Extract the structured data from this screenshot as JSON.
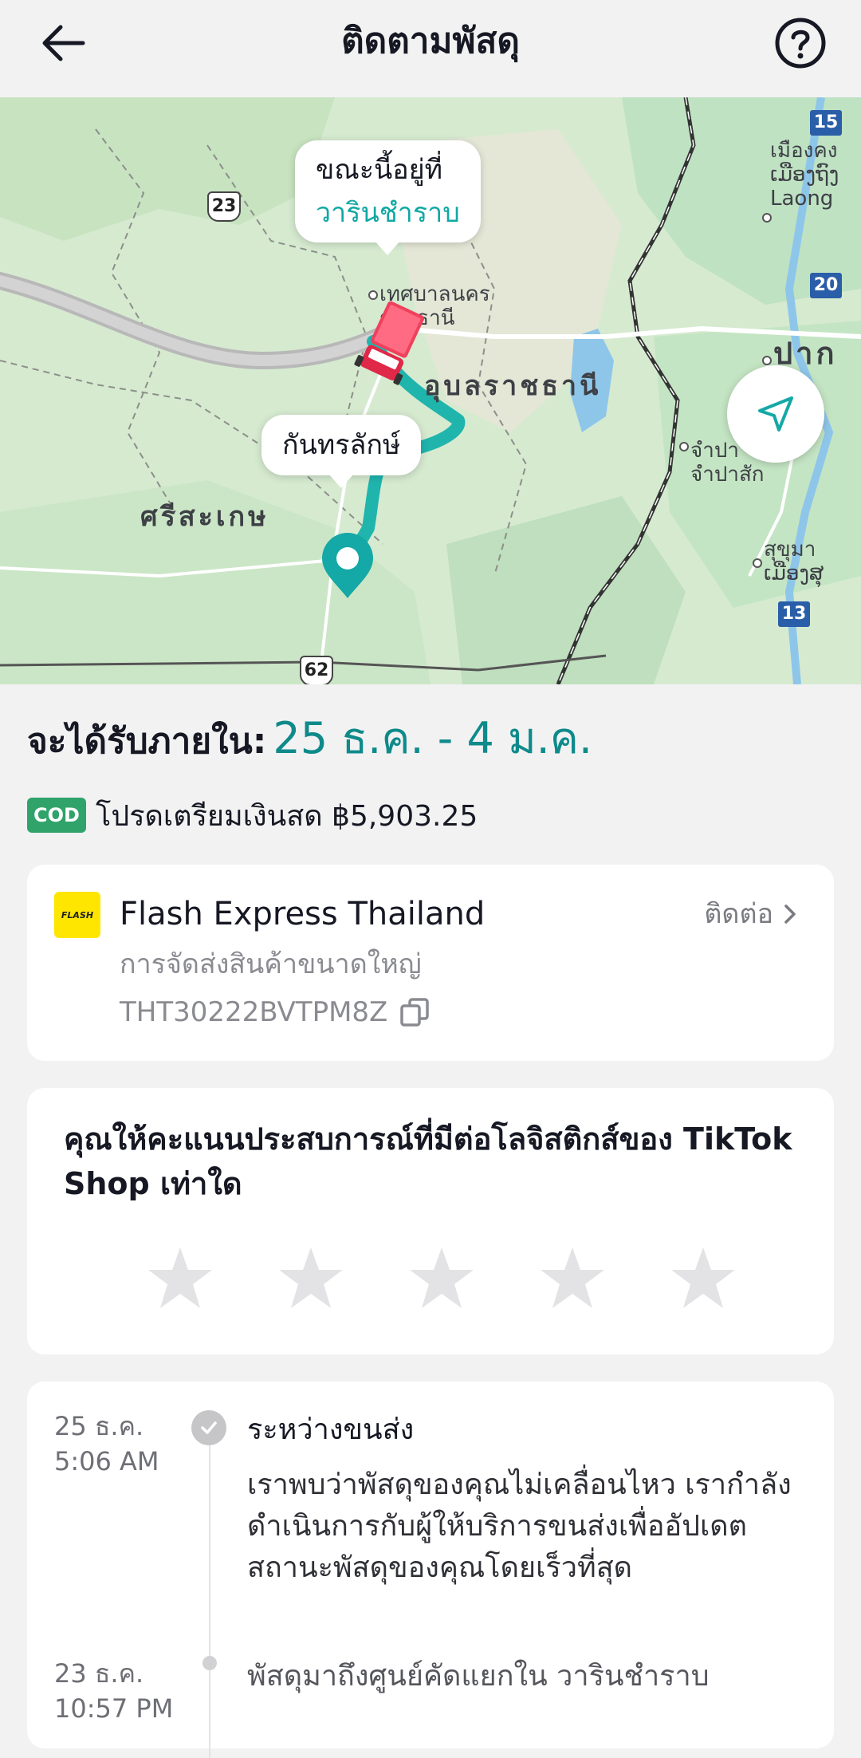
{
  "header": {
    "title": "ติดตามพัสดุ",
    "back_icon": "arrow-left-icon",
    "help_icon": "question-circle-icon"
  },
  "map": {
    "current_location_bubble": {
      "line1": "ขณะนี้อยู่ที่",
      "line2": "วารินชำราบ"
    },
    "destination_bubble": "กันทรลักษ์",
    "labels": {
      "ubon_city": "เทศบาลนคร\nราชธานี",
      "ubon_province": "อุบลราชธานี",
      "sisaket": "ศรีสะเกษ",
      "pakse": "ปากเซ",
      "champasak": "จำปา\nจำปาสัก",
      "khong": "เมืองคง\nເມືອງຖົງ\nLaong",
      "sukhuma": "สุขุมา\nເມືອງສຸ"
    },
    "road_numbers": [
      "23",
      "15",
      "20",
      "13",
      "62"
    ],
    "colors": {
      "route": "#1fb5ad",
      "pin": "#14a8a6",
      "truck": "#f0405c"
    }
  },
  "eta": {
    "label": "จะได้รับภายใน:",
    "date_range": "25 ธ.ค. - 4 ม.ค."
  },
  "cod": {
    "badge": "COD",
    "text": "โปรดเตรียมเงินสด ฿5,903.25"
  },
  "carrier": {
    "logo_text": "FLASH",
    "name": "Flash Express Thailand",
    "contact_label": "ติดต่อ",
    "service": "การจัดส่งสินค้าขนาดใหญ่",
    "tracking_number": "THT30222BVTPM8Z"
  },
  "rating": {
    "question": "คุณให้คะแนนประสบการณ์ที่มีต่อโลจิสติกส์ของ TikTok Shop เท่าใด",
    "stars_selected": 0,
    "stars_total": 5
  },
  "timeline": [
    {
      "date": "25 ธ.ค.",
      "time": "5:06 AM",
      "status": "ระหว่างขนส่ง",
      "description": "เราพบว่าพัสดุของคุณไม่เคลื่อนไหว เรากำลังดำเนินการกับผู้ให้บริการขนส่งเพื่ออัปเดตสถานะพัสดุของคุณโดยเร็วที่สุด"
    },
    {
      "date": "23 ธ.ค.",
      "time": "10:57 PM",
      "status": "",
      "description": "พัสดุมาถึงศูนย์คัดแยกใน วารินชำราบ"
    }
  ]
}
